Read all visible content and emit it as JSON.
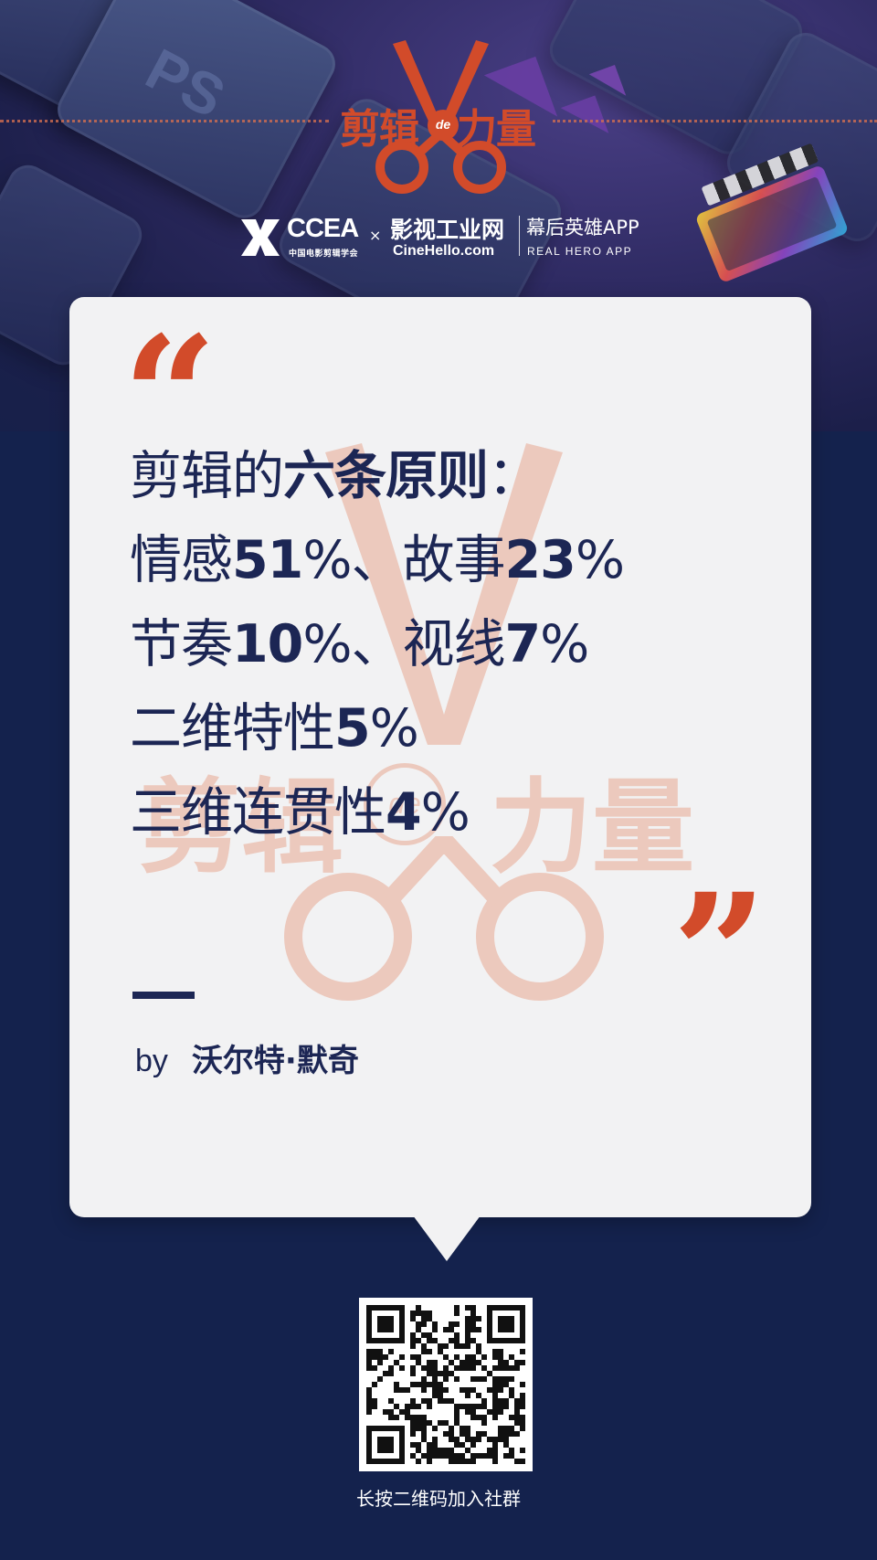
{
  "header": {
    "logo": {
      "text_left": "剪辑",
      "text_mid": "de",
      "text_right": "力量"
    },
    "partners": {
      "ccea_name": "CCEA",
      "ccea_sub": "中国电影剪辑学会",
      "separator": "×",
      "cine_cn": "影视工业网",
      "cine_en": "CineHello.com",
      "hero_cn": "幕后英雄APP",
      "hero_en": "REAL HERO APP"
    }
  },
  "quote": {
    "open_mark": "“",
    "close_mark": "”",
    "lines": [
      [
        {
          "t": "剪辑的",
          "b": false
        },
        {
          "t": "六条原则",
          "b": true
        },
        {
          "t": "：",
          "b": false
        }
      ],
      [
        {
          "t": "情感",
          "b": false
        },
        {
          "t": "51",
          "b": true
        },
        {
          "t": "%、故事",
          "b": false
        },
        {
          "t": "23",
          "b": true
        },
        {
          "t": "%",
          "b": false
        }
      ],
      [
        {
          "t": "节奏",
          "b": false
        },
        {
          "t": "10",
          "b": true
        },
        {
          "t": "%、视线",
          "b": false
        },
        {
          "t": "7",
          "b": true
        },
        {
          "t": "%",
          "b": false
        }
      ],
      [
        {
          "t": "二维特性",
          "b": false
        },
        {
          "t": "5",
          "b": true
        },
        {
          "t": "%",
          "b": false
        }
      ],
      [
        {
          "t": "三维连贯性",
          "b": false
        },
        {
          "t": "4",
          "b": true
        },
        {
          "t": "%",
          "b": false
        }
      ]
    ],
    "by_label": "by",
    "author": "沃尔特·默奇"
  },
  "watermark": {
    "text_left": "剪辑",
    "text_mid": "de",
    "text_right": "力量"
  },
  "footer": {
    "qr_caption": "长按二维码加入社群"
  },
  "colors": {
    "accent": "#d24b2a",
    "navy": "#1c2654",
    "card": "#f2f2f3",
    "background": "#14224d"
  }
}
